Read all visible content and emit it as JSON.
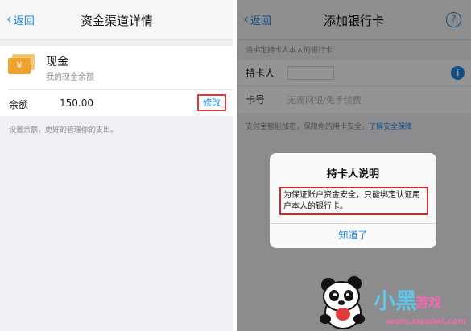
{
  "left": {
    "nav": {
      "back_label": "返回",
      "title": "资金渠道详情"
    },
    "cash": {
      "icon_symbol": "¥",
      "title": "现金",
      "subtitle": "我的现金余额"
    },
    "balance": {
      "label": "余额",
      "value": "150.00",
      "edit_label": "修改"
    },
    "hint": "设置余额，更好的管理你的支出。"
  },
  "right": {
    "nav": {
      "back_label": "返回",
      "title": "添加银行卡",
      "help_symbol": "?"
    },
    "section_title": "请绑定持卡人本人的银行卡",
    "holder": {
      "label": "持卡人",
      "info_symbol": "i"
    },
    "card": {
      "label": "卡号",
      "placeholder": "无需网银/免手续费"
    },
    "security": {
      "text": "支付宝智能加密，保障你的用卡安全，",
      "link": "了解安全保障"
    },
    "dialog": {
      "title": "持卡人说明",
      "message": "为保证账户资金安全，只能绑定认证用户本人的银行卡。",
      "button": "知道了"
    }
  },
  "watermark": {
    "main": "小黑",
    "sub": "游戏",
    "url": "www.xiaohei.com"
  },
  "colors": {
    "link_blue": "#1c8be6",
    "highlight_red": "#d7262b",
    "cash_orange": "#f0a230"
  }
}
